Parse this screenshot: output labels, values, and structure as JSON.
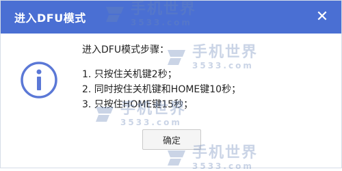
{
  "dialog": {
    "title": "进入DFU模式",
    "close_glyph": "✕"
  },
  "body": {
    "heading": "进入DFU模式步骤：",
    "steps": [
      "1. 只按住关机键2秒；",
      "2. 同时按住关机键和HOME键10秒；",
      "3. 只按住HOME键15秒；"
    ]
  },
  "buttons": {
    "ok": "确定"
  },
  "watermark": {
    "name": "手机世界",
    "site": "3533.com"
  },
  "icons": {
    "info": "info-icon",
    "close": "close-icon"
  },
  "colors": {
    "titlebar": "#4a6fd3",
    "icon": "#5b78d6"
  }
}
